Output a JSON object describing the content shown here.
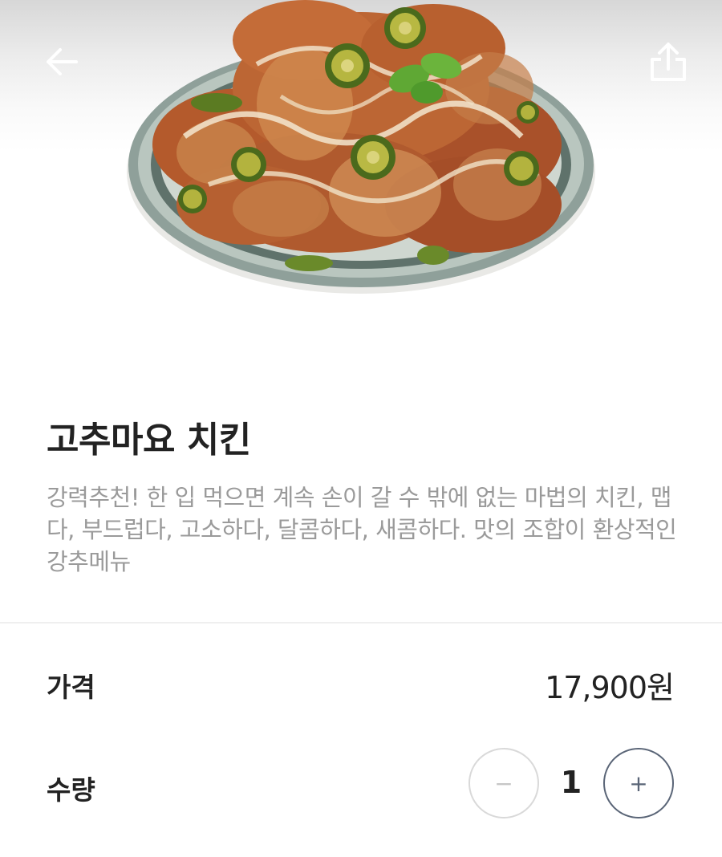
{
  "header": {
    "back_icon": "arrow-left-icon",
    "share_icon": "share-icon"
  },
  "hero": {
    "image": "fried-chicken-with-jalapeno-and-mayo-on-plate"
  },
  "product": {
    "title": "고추마요 치킨",
    "description": "강력추천! 한 입 먹으면 계속 손이 갈 수 밖에 없는 마법의 치킨, 맵다, 부드럽다, 고소하다, 달콤하다, 새콤하다. 맛의 조합이 환상적인 강추메뉴"
  },
  "price": {
    "label": "가격",
    "value": "17,900원"
  },
  "quantity": {
    "label": "수량",
    "value": "1",
    "minus_label": "−",
    "plus_label": "+"
  },
  "colors": {
    "title_text": "#222222",
    "description_text": "#9a9a9a",
    "minus_disabled": "#d9d9d9",
    "plus_active": "#5a6577"
  }
}
